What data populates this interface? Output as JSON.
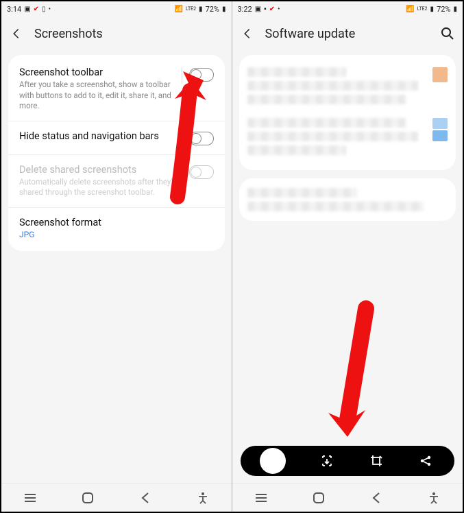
{
  "left": {
    "statusbar": {
      "time": "3:14",
      "battery": "72%",
      "net": "LTE2"
    },
    "appbar": {
      "title": "Screenshots"
    },
    "settings": [
      {
        "title": "Screenshot toolbar",
        "desc": "After you take a screenshot, show a toolbar with buttons to add to it, edit it, share it, and more.",
        "toggle": true,
        "divider": true
      },
      {
        "title": "Hide status and navigation bars",
        "toggle": true
      },
      {
        "title": "Delete shared screenshots",
        "desc": "Automatically delete screenshots after they're shared through the screenshot toolbar.",
        "toggle": true,
        "disabled": true
      },
      {
        "title": "Screenshot format",
        "sub": "JPG"
      }
    ]
  },
  "right": {
    "statusbar": {
      "time": "3:22",
      "battery": "72%",
      "net": "LTE2"
    },
    "appbar": {
      "title": "Software update"
    },
    "toolbar_icons": [
      "thumbnail",
      "scroll-capture",
      "crop",
      "share"
    ]
  },
  "nav_icons": [
    "recents",
    "home",
    "back",
    "accessibility"
  ]
}
